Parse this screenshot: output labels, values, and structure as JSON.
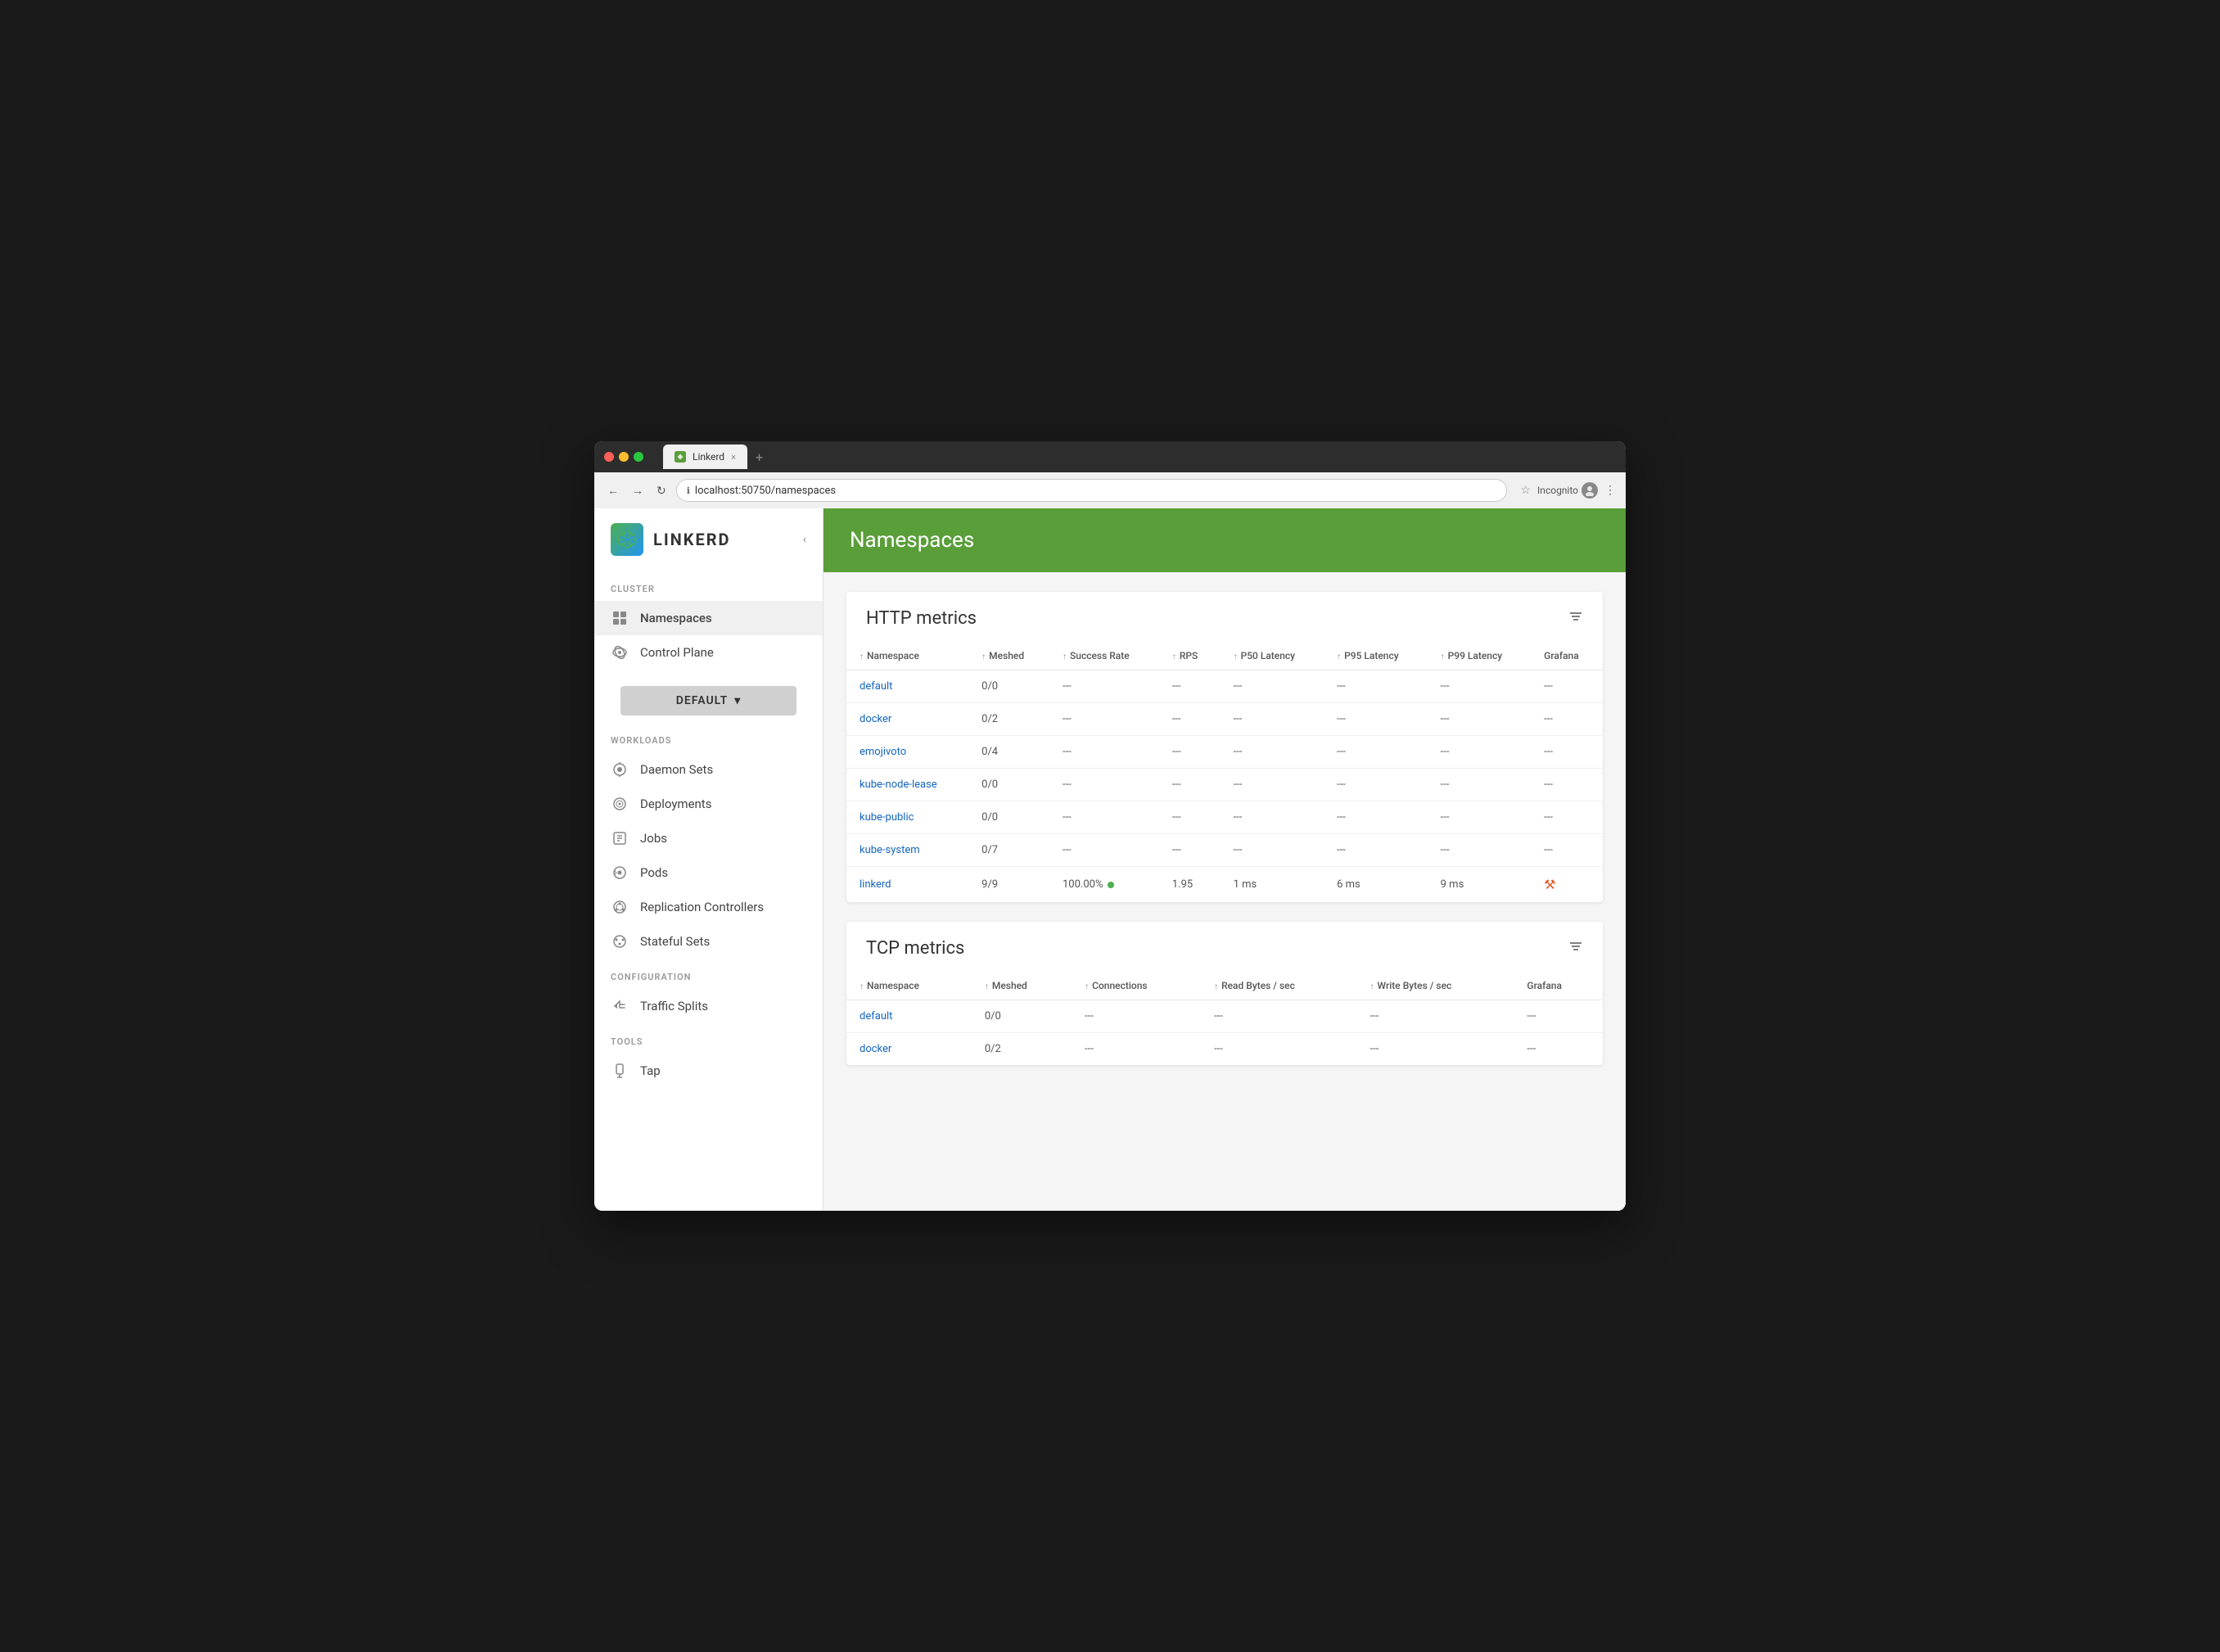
{
  "browser": {
    "tab_title": "Linkerd",
    "tab_close": "×",
    "new_tab": "+",
    "url": "localhost:50750/namespaces",
    "back_btn": "←",
    "forward_btn": "→",
    "refresh_btn": "↻",
    "info_icon": "ℹ",
    "star": "☆",
    "incognito_label": "Incognito",
    "menu": "⋮"
  },
  "sidebar": {
    "logo_text": "LINKERD",
    "collapse_icon": "‹",
    "cluster_label": "CLUSTER",
    "cluster_items": [
      {
        "id": "namespaces",
        "label": "Namespaces",
        "active": true
      },
      {
        "id": "control-plane",
        "label": "Control Plane",
        "active": false
      }
    ],
    "namespace_selector_label": "DEFAULT",
    "namespace_dropdown_icon": "▾",
    "workloads_label": "WORKLOADS",
    "workload_items": [
      {
        "id": "daemon-sets",
        "label": "Daemon Sets"
      },
      {
        "id": "deployments",
        "label": "Deployments"
      },
      {
        "id": "jobs",
        "label": "Jobs"
      },
      {
        "id": "pods",
        "label": "Pods"
      },
      {
        "id": "replication-controllers",
        "label": "Replication Controllers"
      },
      {
        "id": "stateful-sets",
        "label": "Stateful Sets"
      }
    ],
    "configuration_label": "CONFIGURATION",
    "config_items": [
      {
        "id": "traffic-splits",
        "label": "Traffic Splits"
      }
    ],
    "tools_label": "TOOLS",
    "tool_items": [
      {
        "id": "tap",
        "label": "Tap"
      }
    ]
  },
  "page": {
    "title": "Namespaces"
  },
  "http_metrics": {
    "title": "HTTP metrics",
    "columns": [
      {
        "label": "Namespace",
        "sortable": true
      },
      {
        "label": "Meshed",
        "sortable": true
      },
      {
        "label": "Success Rate",
        "sortable": true
      },
      {
        "label": "RPS",
        "sortable": true
      },
      {
        "label": "P50 Latency",
        "sortable": true
      },
      {
        "label": "P95 Latency",
        "sortable": true
      },
      {
        "label": "P99 Latency",
        "sortable": true
      },
      {
        "label": "Grafana",
        "sortable": false
      }
    ],
    "rows": [
      {
        "namespace": "default",
        "meshed": "0/0",
        "success_rate": "---",
        "rps": "---",
        "p50": "---",
        "p95": "---",
        "p99": "---",
        "grafana": "---",
        "has_grafana": false,
        "is_linkerd": false
      },
      {
        "namespace": "docker",
        "meshed": "0/2",
        "success_rate": "---",
        "rps": "---",
        "p50": "---",
        "p95": "---",
        "p99": "---",
        "grafana": "---",
        "has_grafana": false,
        "is_linkerd": false
      },
      {
        "namespace": "emojivoto",
        "meshed": "0/4",
        "success_rate": "---",
        "rps": "---",
        "p50": "---",
        "p95": "---",
        "p99": "---",
        "grafana": "---",
        "has_grafana": false,
        "is_linkerd": false
      },
      {
        "namespace": "kube-node-lease",
        "meshed": "0/0",
        "success_rate": "---",
        "rps": "---",
        "p50": "---",
        "p95": "---",
        "p99": "---",
        "grafana": "---",
        "has_grafana": false,
        "is_linkerd": false
      },
      {
        "namespace": "kube-public",
        "meshed": "0/0",
        "success_rate": "---",
        "rps": "---",
        "p50": "---",
        "p95": "---",
        "p99": "---",
        "grafana": "---",
        "has_grafana": false,
        "is_linkerd": false
      },
      {
        "namespace": "kube-system",
        "meshed": "0/7",
        "success_rate": "---",
        "rps": "---",
        "p50": "---",
        "p95": "---",
        "p99": "---",
        "grafana": "---",
        "has_grafana": false,
        "is_linkerd": false
      },
      {
        "namespace": "linkerd",
        "meshed": "9/9",
        "success_rate": "100.00%",
        "rps": "1.95",
        "p50": "1 ms",
        "p95": "6 ms",
        "p99": "9 ms",
        "grafana": "",
        "has_grafana": true,
        "is_linkerd": true
      }
    ]
  },
  "tcp_metrics": {
    "title": "TCP metrics",
    "columns": [
      {
        "label": "Namespace",
        "sortable": true
      },
      {
        "label": "Meshed",
        "sortable": true
      },
      {
        "label": "Connections",
        "sortable": true
      },
      {
        "label": "Read Bytes / sec",
        "sortable": true
      },
      {
        "label": "Write Bytes / sec",
        "sortable": true
      },
      {
        "label": "Grafana",
        "sortable": false
      }
    ],
    "rows": [
      {
        "namespace": "default",
        "meshed": "0/0",
        "connections": "---",
        "read_bytes": "---",
        "write_bytes": "---",
        "grafana": "---"
      },
      {
        "namespace": "docker",
        "meshed": "0/2",
        "connections": "---",
        "read_bytes": "---",
        "write_bytes": "---",
        "grafana": "---"
      }
    ]
  }
}
